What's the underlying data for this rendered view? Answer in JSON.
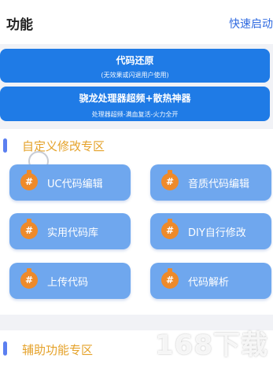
{
  "header": {
    "title": "功能",
    "quick_start": "快速启动"
  },
  "buttons": [
    {
      "label": "代码还原",
      "sub": "(无效果或闪退用户使用)"
    },
    {
      "label": "骁龙处理器超频+散热神器",
      "sub": "处理器超频-满血复活-火力全开"
    }
  ],
  "custom_section": {
    "title": "自定义修改专区",
    "tiles": [
      "UC代码编辑",
      "音质代码编辑",
      "实用代码库",
      "DIY自行修改",
      "上传代码",
      "代码解析"
    ]
  },
  "aux_section": {
    "title": "辅助功能专区"
  },
  "watermark": "168下载",
  "tile_icon": "#",
  "colors": {
    "accent": "#1f7be6",
    "tile": "#6fa7ee",
    "icon": "#ee8a2a",
    "section_title": "#e5a22a"
  }
}
